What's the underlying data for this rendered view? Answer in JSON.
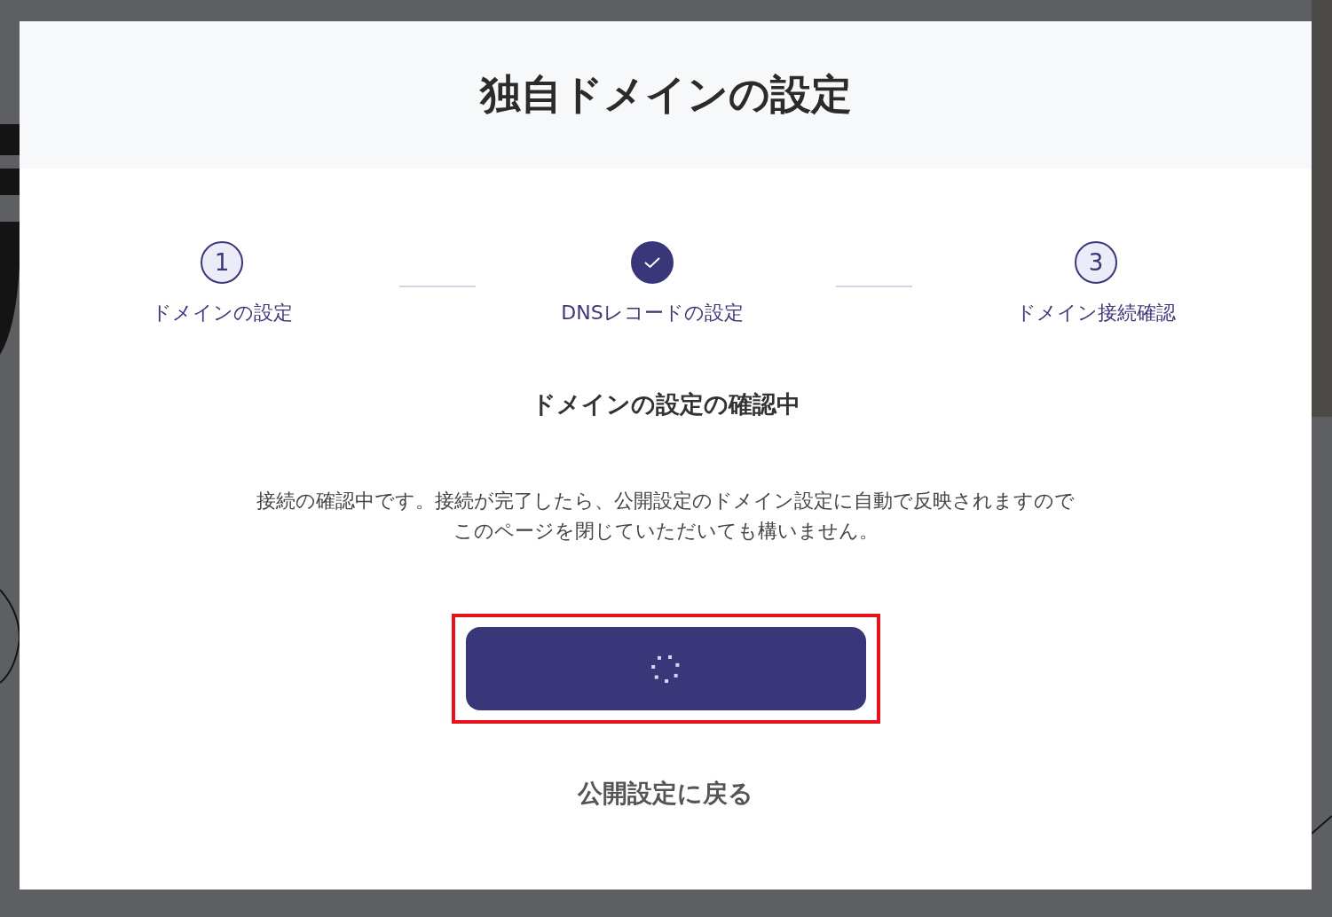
{
  "dialog": {
    "title": "独自ドメインの設定",
    "steps": [
      {
        "number": "1",
        "label": "ドメインの設定",
        "completed": false
      },
      {
        "label": "DNSレコードの設定",
        "completed": true
      },
      {
        "number": "3",
        "label": "ドメイン接続確認",
        "completed": false
      }
    ],
    "heading": "ドメインの設定の確認中",
    "message": [
      "接続の確認中です。接続が完了したら、公開設定のドメイン設定に自動で反映されますので",
      "このページを閉じていただいても構いません。"
    ],
    "button": {
      "loading": true,
      "highlighted": true
    },
    "back_link": "公開設定に戻る"
  }
}
